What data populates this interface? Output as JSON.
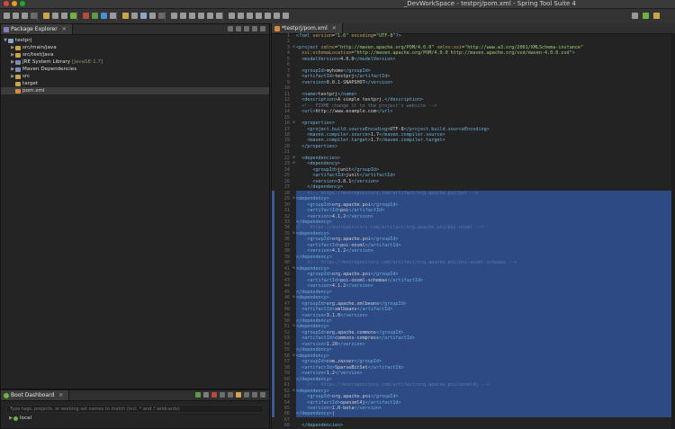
{
  "window": {
    "title": "_DevWorkSpace - testprj/pom.xml - Spring Tool Suite 4"
  },
  "explorer": {
    "tab_label": "Package Explorer",
    "items": [
      {
        "label": "testprj",
        "depth": 0,
        "twisty": "▼",
        "icon_color": "#8aa6c8"
      },
      {
        "label": "src/main/java",
        "depth": 1,
        "twisty": "▶",
        "icon_color": "#c9a64a"
      },
      {
        "label": "src/test/java",
        "depth": 1,
        "twisty": "▶",
        "icon_color": "#c9a64a"
      },
      {
        "label": "JRE System Library",
        "decoration": "[JavaSE-1.7]",
        "depth": 1,
        "twisty": "▶",
        "icon_color": "#7c8fb0"
      },
      {
        "label": "Maven Dependencies",
        "depth": 1,
        "twisty": "▶",
        "icon_color": "#7c8fb0"
      },
      {
        "label": "src",
        "depth": 1,
        "twisty": "▶",
        "icon_color": "#c9a64a"
      },
      {
        "label": "target",
        "depth": 1,
        "twisty": "",
        "icon_color": "#c9a64a"
      },
      {
        "label": "pom.xml",
        "depth": 1,
        "twisty": "",
        "icon_color": "#d98a3b",
        "selected": true
      }
    ]
  },
  "boot": {
    "tab_label": "Boot Dashboard",
    "search_placeholder": "Type tags, projects, or working set names to match (incl. * and ? wildcards)",
    "items": [
      {
        "label": "local",
        "twisty": "▶"
      }
    ]
  },
  "editor": {
    "tab_label": "*testprj/pom.xml",
    "lines": [
      {
        "n": "1",
        "html": "<span class=\"tg\">&lt;?xml</span> <span class=\"at\">version</span>=<span class=\"av\">\"1.0\"</span> <span class=\"at\">encoding</span>=<span class=\"av\">\"UTF-8\"</span><span class=\"tg\">?&gt;</span>"
      },
      {
        "n": "2",
        "html": ""
      },
      {
        "n": "3",
        "fold": "⊖",
        "html": "<span class=\"tg\">&lt;project</span> <span class=\"at\">xmlns</span>=<span class=\"av\">\"http://maven.apache.org/POM/4.0.0\"</span> <span class=\"at\">xmlns:xsi</span>=<span class=\"av\">\"http://www.w3.org/2001/XMLSchema-instance\"</span>"
      },
      {
        "n": "4",
        "html": "  <span class=\"at\">xsi:schemaLocation</span>=<span class=\"av\">\"http://maven.apache.org/POM/4.0.0 http://maven.apache.org/xsd/maven-4.0.0.xsd\"</span><span class=\"tg\">&gt;</span>"
      },
      {
        "n": "5",
        "html": "  <span class=\"tg\">&lt;modelVersion&gt;</span>4.0.0<span class=\"tg\">&lt;/modelVersion&gt;</span>"
      },
      {
        "n": "6",
        "html": ""
      },
      {
        "n": "7",
        "html": "  <span class=\"tg\">&lt;groupId&gt;</span>myhome<span class=\"tg\">&lt;/groupId&gt;</span>"
      },
      {
        "n": "8",
        "html": "  <span class=\"tg\">&lt;artifactId&gt;</span>testprj<span class=\"tg\">&lt;/artifactId&gt;</span>"
      },
      {
        "n": "9",
        "html": "  <span class=\"tg\">&lt;version&gt;</span>0.0.1-SNAPSHOT<span class=\"tg\">&lt;/version&gt;</span>"
      },
      {
        "n": "10",
        "html": ""
      },
      {
        "n": "11",
        "html": "  <span class=\"tg\">&lt;name&gt;</span>testprj<span class=\"tg\">&lt;/name&gt;</span>"
      },
      {
        "n": "12",
        "html": "  <span class=\"tg\">&lt;description&gt;</span>A simple testprj.<span class=\"tg\">&lt;/description&gt;</span>"
      },
      {
        "n": "13",
        "html": "  <span class=\"cm\">&lt;!-- FIXME change it to the project's website --&gt;</span>"
      },
      {
        "n": "14",
        "html": "  <span class=\"tg\">&lt;url&gt;</span>http://www.example.com<span class=\"tg\">&lt;/url&gt;</span>"
      },
      {
        "n": "15",
        "html": ""
      },
      {
        "n": "16",
        "fold": "⊖",
        "html": "  <span class=\"tg\">&lt;properties&gt;</span>"
      },
      {
        "n": "17",
        "html": "    <span class=\"tg\">&lt;project.build.sourceEncoding&gt;</span>UTF-8<span class=\"tg\">&lt;/project.build.sourceEncoding&gt;</span>"
      },
      {
        "n": "18",
        "html": "    <span class=\"tg\">&lt;maven.compiler.source&gt;</span>1.7<span class=\"tg\">&lt;/maven.compiler.source&gt;</span>"
      },
      {
        "n": "19",
        "html": "    <span class=\"tg\">&lt;maven.compiler.target&gt;</span>1.7<span class=\"tg\">&lt;/maven.compiler.target&gt;</span>"
      },
      {
        "n": "20",
        "html": "  <span class=\"tg\">&lt;/properties&gt;</span>"
      },
      {
        "n": "21",
        "html": ""
      },
      {
        "n": "22",
        "fold": "⊖",
        "html": "  <span class=\"tg\">&lt;dependencies&gt;</span>"
      },
      {
        "n": "23",
        "fold": "⊖",
        "html": "    <span class=\"tg\">&lt;dependency&gt;</span>"
      },
      {
        "n": "24",
        "html": "      <span class=\"tg\">&lt;groupId&gt;</span>junit<span class=\"tg\">&lt;/groupId&gt;</span>"
      },
      {
        "n": "25",
        "html": "      <span class=\"tg\">&lt;artifactId&gt;</span>junit<span class=\"tg\">&lt;/artifactId&gt;</span>"
      },
      {
        "n": "26",
        "html": "      <span class=\"tg\">&lt;version&gt;</span>3.8.1<span class=\"tg\">&lt;/version&gt;</span>"
      },
      {
        "n": "27",
        "html": "    <span class=\"tg\">&lt;/dependency&gt;</span>"
      },
      {
        "n": "28",
        "sel": true,
        "html": "<span class=\"cm-sel\">    &lt;!-- https://mvnrepository.com/artifact/org.apache.poi/poi --&gt;</span>"
      },
      {
        "n": "29",
        "sel": true,
        "fold": "⊖",
        "html": "<span class=\"tg\">&lt;dependency&gt;</span>"
      },
      {
        "n": "30",
        "sel": true,
        "html": "    <span class=\"tg\">&lt;groupId&gt;</span>org.apache.poi<span class=\"tg\">&lt;/groupId&gt;</span>"
      },
      {
        "n": "31",
        "sel": true,
        "html": "    <span class=\"tg\">&lt;artifactId&gt;</span>poi<span class=\"tg\">&lt;/artifactId&gt;</span>"
      },
      {
        "n": "32",
        "sel": true,
        "html": "    <span class=\"tg\">&lt;version&gt;</span>4.1.2<span class=\"tg\">&lt;/version&gt;</span>"
      },
      {
        "n": "33",
        "sel": true,
        "html": "<span class=\"tg\">&lt;/dependency&gt;</span>"
      },
      {
        "n": "34",
        "sel": true,
        "html": "<span class=\"cm-sel\">&lt;!-- https://mvnrepository.com/artifact/org.apache.poi/poi-ooxml --&gt;</span>"
      },
      {
        "n": "35",
        "sel": true,
        "fold": "⊖",
        "html": "<span class=\"tg\">&lt;dependency&gt;</span>"
      },
      {
        "n": "36",
        "sel": true,
        "html": "    <span class=\"tg\">&lt;groupId&gt;</span>org.apache.poi<span class=\"tg\">&lt;/groupId&gt;</span>"
      },
      {
        "n": "37",
        "sel": true,
        "html": "    <span class=\"tg\">&lt;artifactId&gt;</span>poi-ooxml<span class=\"tg\">&lt;/artifactId&gt;</span>"
      },
      {
        "n": "38",
        "sel": true,
        "html": "    <span class=\"tg\">&lt;version&gt;</span>4.1.2<span class=\"tg\">&lt;/version&gt;</span>"
      },
      {
        "n": "39",
        "sel": true,
        "html": "<span class=\"tg\">&lt;/dependency&gt;</span>"
      },
      {
        "n": "40",
        "sel": true,
        "html": "<span class=\"cm-sel\">    &lt;!-- https://mvnrepository.com/artifact/org.apache.poi/poi-ooxml-schemas --&gt;</span>"
      },
      {
        "n": "41",
        "sel": true,
        "fold": "⊖",
        "html": "<span class=\"tg\">&lt;dependency&gt;</span>"
      },
      {
        "n": "42",
        "sel": true,
        "html": "    <span class=\"tg\">&lt;groupId&gt;</span>org.apache.poi<span class=\"tg\">&lt;/groupId&gt;</span>"
      },
      {
        "n": "43",
        "sel": true,
        "html": "    <span class=\"tg\">&lt;artifactId&gt;</span>poi-ooxml-schemas<span class=\"tg\">&lt;/artifactId&gt;</span>"
      },
      {
        "n": "44",
        "sel": true,
        "html": "    <span class=\"tg\">&lt;version&gt;</span>4.1.2<span class=\"tg\">&lt;/version&gt;</span>"
      },
      {
        "n": "45",
        "sel": true,
        "html": "<span class=\"tg\">&lt;/dependency&gt;</span>"
      },
      {
        "n": "46",
        "sel": true,
        "fold": "⊖",
        "html": "<span class=\"tg\">&lt;dependency&gt;</span>"
      },
      {
        "n": "47",
        "sel": true,
        "html": "  <span class=\"tg\">&lt;groupId&gt;</span>org.apache.xmlbeans<span class=\"tg\">&lt;/groupId&gt;</span>"
      },
      {
        "n": "48",
        "sel": true,
        "html": "  <span class=\"tg\">&lt;artifactId&gt;</span>xmlbeans<span class=\"tg\">&lt;/artifactId&gt;</span>"
      },
      {
        "n": "49",
        "sel": true,
        "html": "  <span class=\"tg\">&lt;version&gt;</span>3.1.0<span class=\"tg\">&lt;/version&gt;</span>"
      },
      {
        "n": "50",
        "sel": true,
        "html": "<span class=\"tg\">&lt;/dependency&gt;</span>"
      },
      {
        "n": "51",
        "sel": true,
        "fold": "⊖",
        "html": "<span class=\"tg\">&lt;dependency&gt;</span>"
      },
      {
        "n": "52",
        "sel": true,
        "html": "  <span class=\"tg\">&lt;groupId&gt;</span>org.apache.commons<span class=\"tg\">&lt;/groupId&gt;</span>"
      },
      {
        "n": "53",
        "sel": true,
        "html": "  <span class=\"tg\">&lt;artifactId&gt;</span>commons-compress<span class=\"tg\">&lt;/artifactId&gt;</span>"
      },
      {
        "n": "54",
        "sel": true,
        "html": "  <span class=\"tg\">&lt;version&gt;</span>1.20<span class=\"tg\">&lt;/version&gt;</span>"
      },
      {
        "n": "55",
        "sel": true,
        "html": "<span class=\"tg\">&lt;/dependency&gt;</span>"
      },
      {
        "n": "56",
        "sel": true,
        "fold": "⊖",
        "html": "<span class=\"tg\">&lt;dependency&gt;</span>"
      },
      {
        "n": "57",
        "sel": true,
        "html": "  <span class=\"tg\">&lt;groupId&gt;</span>com.zaxxer<span class=\"tg\">&lt;/groupId&gt;</span>"
      },
      {
        "n": "58",
        "sel": true,
        "html": "  <span class=\"tg\">&lt;artifactId&gt;</span>SparseBitSet<span class=\"tg\">&lt;/artifactId&gt;</span>"
      },
      {
        "n": "59",
        "sel": true,
        "html": "  <span class=\"tg\">&lt;version&gt;</span>1.2<span class=\"tg\">&lt;/version&gt;</span>"
      },
      {
        "n": "60",
        "sel": true,
        "html": "<span class=\"tg\">&lt;/dependency&gt;</span>"
      },
      {
        "n": "61",
        "sel": true,
        "html": "<span class=\"cm-sel\">    &lt;!-- https://mvnrepository.com/artifact/org.apache.poi/ooxml4j --&gt;</span>"
      },
      {
        "n": "62",
        "sel": true,
        "fold": "⊖",
        "html": "<span class=\"tg\">&lt;dependency&gt;</span>"
      },
      {
        "n": "63",
        "sel": true,
        "html": "    <span class=\"tg\">&lt;groupId&gt;</span>org.apache.poi<span class=\"tg\">&lt;/groupId&gt;</span>"
      },
      {
        "n": "64",
        "sel": true,
        "html": "    <span class=\"tg\">&lt;artifactId&gt;</span>openxml4j<span class=\"tg\">&lt;/artifactId&gt;</span>"
      },
      {
        "n": "65",
        "sel": true,
        "html": "    <span class=\"tg\">&lt;version&gt;</span>1.0-beta<span class=\"tg\">&lt;/version&gt;</span>"
      },
      {
        "n": "66",
        "sel": true,
        "html": "<span class=\"tg\">&lt;/dependency&gt;</span>|"
      },
      {
        "n": "67",
        "html": ""
      },
      {
        "n": "68",
        "html": "  <span class=\"tg\">&lt;/dependencies&gt;</span>"
      }
    ]
  }
}
